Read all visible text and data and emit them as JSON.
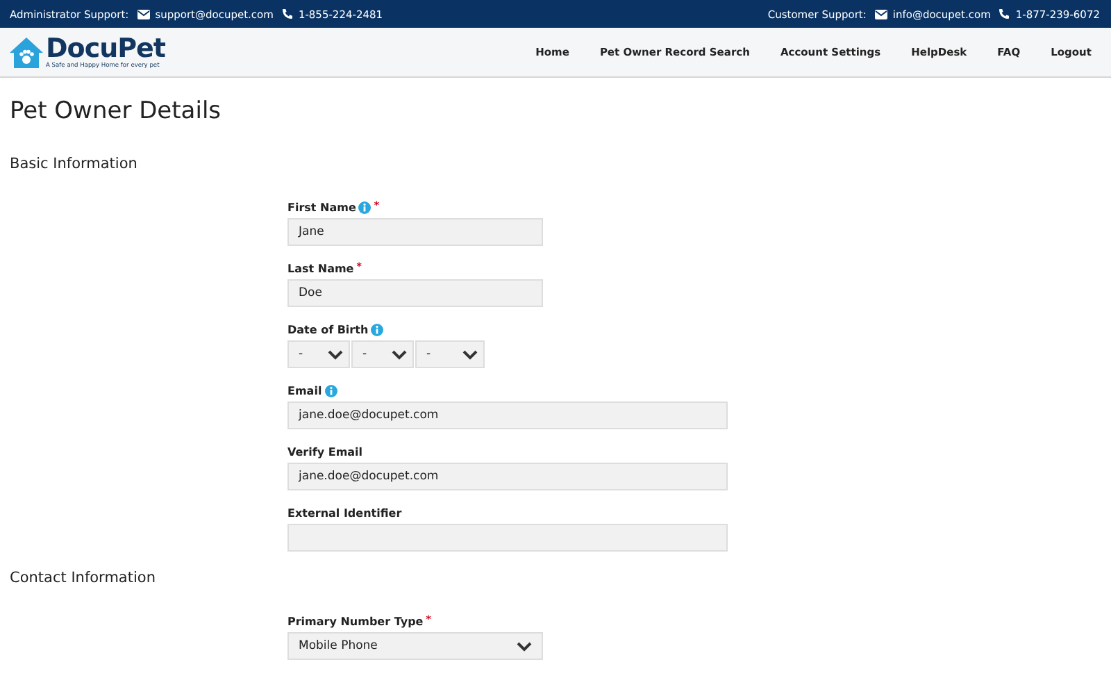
{
  "top_bar": {
    "admin": {
      "label": "Administrator Support:",
      "email": "support@docupet.com",
      "phone": "1-855-224-2481"
    },
    "customer": {
      "label": "Customer Support:",
      "email": "info@docupet.com",
      "phone": "1-877-239-6072"
    }
  },
  "logo": {
    "name": "DocuPet",
    "tagline": "A Safe and Happy Home for every pet"
  },
  "nav": [
    {
      "label": "Home"
    },
    {
      "label": "Pet Owner Record Search"
    },
    {
      "label": "Account Settings"
    },
    {
      "label": "HelpDesk"
    },
    {
      "label": "FAQ"
    },
    {
      "label": "Logout"
    }
  ],
  "title": "Pet Owner Details",
  "sections": [
    {
      "heading": "Basic Information",
      "fields": [
        {
          "kind": "short",
          "label": "First Name",
          "info": true,
          "required_mark": "*",
          "value": "Jane"
        },
        {
          "kind": "short",
          "label": "Last Name",
          "info": false,
          "required_mark": "*",
          "value": "Doe"
        },
        {
          "kind": "date",
          "label": "Date of Birth",
          "info": true,
          "parts": [
            "-",
            "-",
            "-"
          ]
        },
        {
          "kind": "long",
          "label": "Email",
          "info": true,
          "value": "jane.doe@docupet.com"
        },
        {
          "kind": "long",
          "label": "Verify Email",
          "info": false,
          "value": "jane.doe@docupet.com"
        },
        {
          "kind": "long",
          "label": "External Identifier",
          "info": false
        }
      ]
    },
    {
      "heading": "Contact Information",
      "fields": [
        {
          "kind": "select",
          "label": "Primary Number Type",
          "info": false,
          "required_mark": "*",
          "value": "Mobile Phone"
        }
      ]
    }
  ]
}
